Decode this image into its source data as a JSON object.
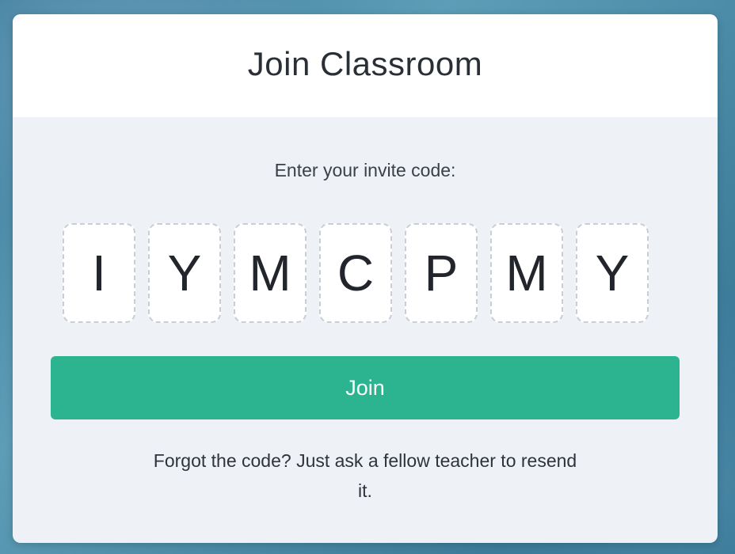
{
  "dialog": {
    "title": "Join Classroom",
    "prompt": "Enter your invite code:",
    "code": [
      "I",
      "Y",
      "M",
      "C",
      "P",
      "M",
      "Y"
    ],
    "join_label": "Join",
    "help_text": "Forgot the code? Just ask a fellow teacher to resend it."
  },
  "colors": {
    "accent": "#2cb390",
    "body_background": "#eef1f5",
    "header_background": "#ffffff"
  }
}
